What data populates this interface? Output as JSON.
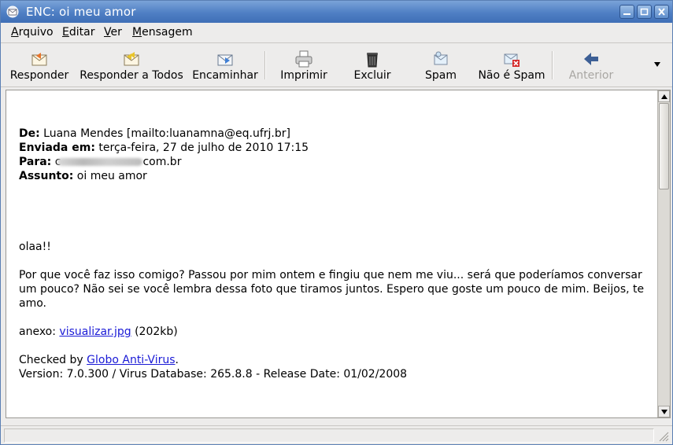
{
  "window": {
    "title": "ENC: oi meu amor",
    "accent": "#4f7fc4",
    "link_color": "#1a1ad6"
  },
  "menu": {
    "items": [
      "Arquivo",
      "Editar",
      "Ver",
      "Mensagem"
    ]
  },
  "toolbar": {
    "reply": "Responder",
    "reply_all": "Responder a Todos",
    "forward": "Encaminhar",
    "print": "Imprimir",
    "delete": "Excluir",
    "spam": "Spam",
    "not_spam": "Não é Spam",
    "previous": "Anterior"
  },
  "message": {
    "from_label": "De:",
    "from_value": "Luana Mendes [mailto:luanamna@eq.ufrj.br]",
    "sent_label": "Enviada em:",
    "sent_value": "terça-feira, 27 de julho de 2010 17:15",
    "to_label": "Para:",
    "to_prefix": "c",
    "to_suffix": "com.br",
    "subject_label": "Assunto:",
    "subject_value": "oi meu amor",
    "greeting": "olaa!!",
    "body": "Por que você faz isso comigo? Passou por mim ontem e fingiu que nem me viu... será que poderíamos conversar um pouco? Não sei se você lembra dessa foto que tiramos juntos. Espero que goste um pouco de mim. Beijos, te amo.",
    "attachment_label": "anexo:",
    "attachment_link": "visualizar.jpg",
    "attachment_size": "(202kb)",
    "checked_by": "Checked by",
    "av_link": "Globo Anti-Virus",
    "av_period": ".",
    "version": "Version: 7.0.300 / Virus Database: 265.8.8 - Release Date: 01/02/2008"
  }
}
